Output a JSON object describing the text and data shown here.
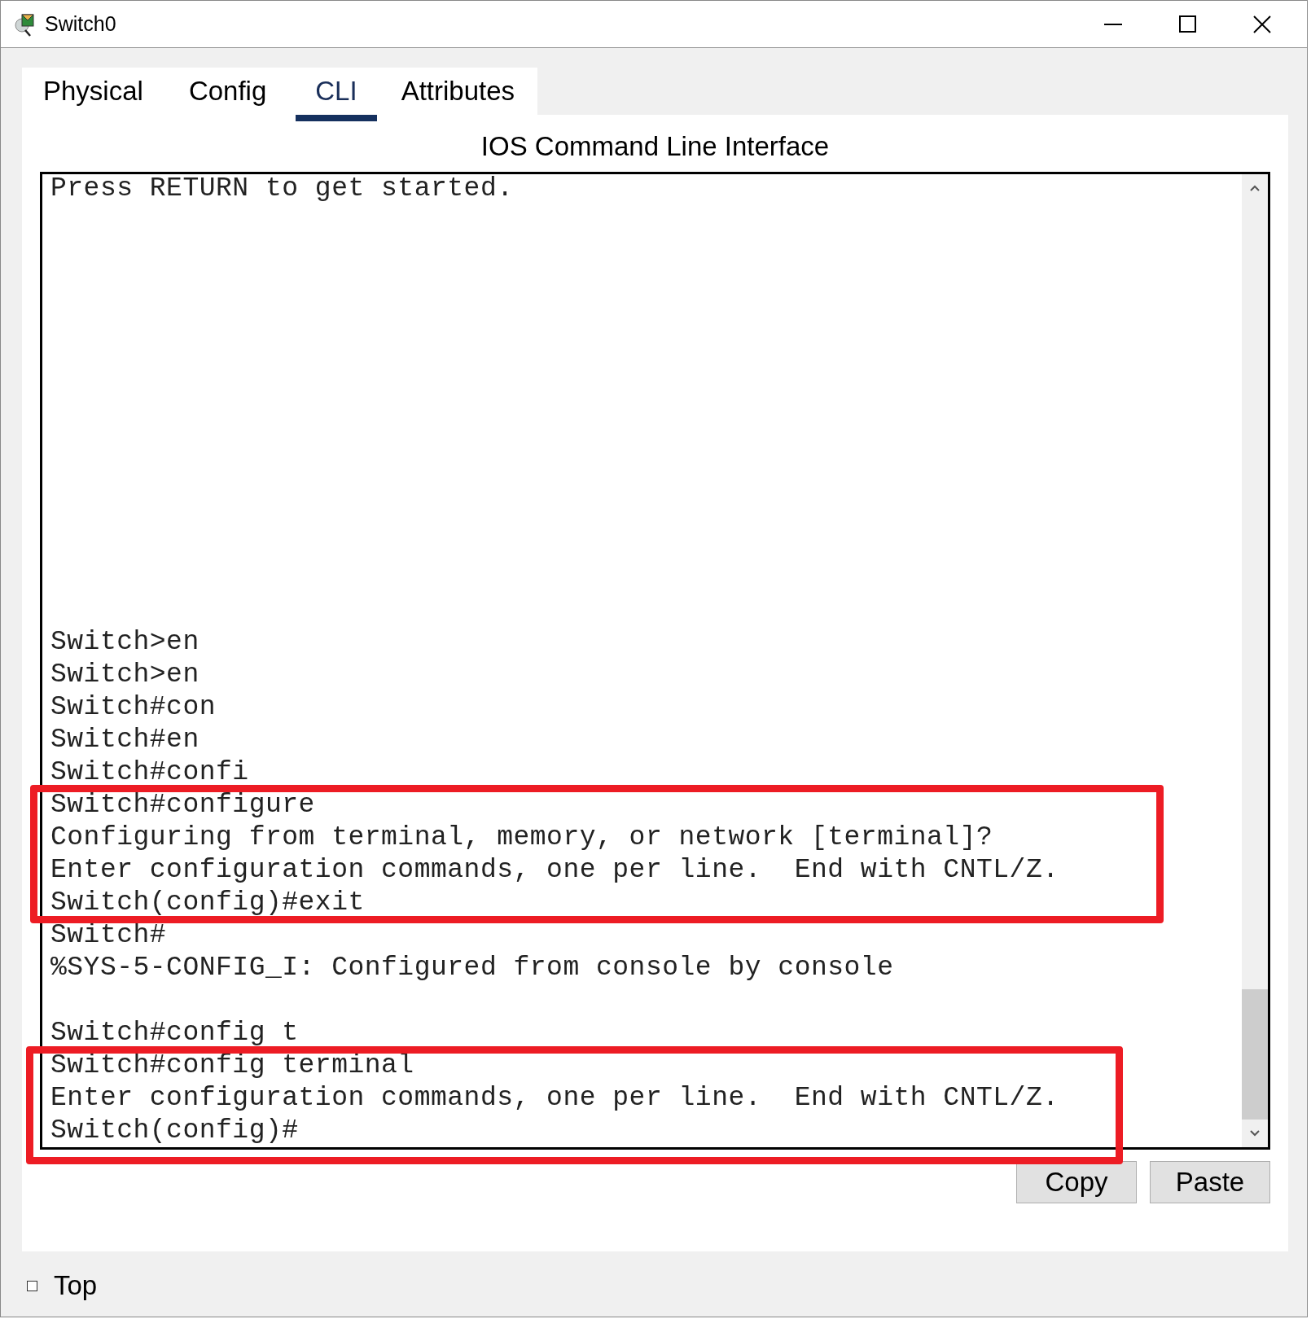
{
  "window": {
    "title": "Switch0"
  },
  "tabs": [
    {
      "label": "Physical",
      "selected": false
    },
    {
      "label": "Config",
      "selected": false
    },
    {
      "label": "CLI",
      "selected": true
    },
    {
      "label": "Attributes",
      "selected": false
    }
  ],
  "cli": {
    "heading": "IOS Command Line Interface",
    "output_blocks": [
      [
        "Press RETURN to get started."
      ],
      [
        "Switch>en",
        "Switch>en",
        "Switch#con",
        "Switch#en",
        "Switch#confi",
        "Switch#configure",
        "Configuring from terminal, memory, or network [terminal]?",
        "Enter configuration commands, one per line.  End with CNTL/Z.",
        "Switch(config)#exit",
        "Switch#",
        "%SYS-5-CONFIG_I: Configured from console by console"
      ],
      [
        "Switch#config t",
        "Switch#config terminal",
        "Enter configuration commands, one per line.  End with CNTL/Z.",
        "Switch(config)#"
      ]
    ],
    "buttons": [
      "Copy",
      "Paste"
    ]
  },
  "top": {
    "label": "Top",
    "checked": false
  }
}
